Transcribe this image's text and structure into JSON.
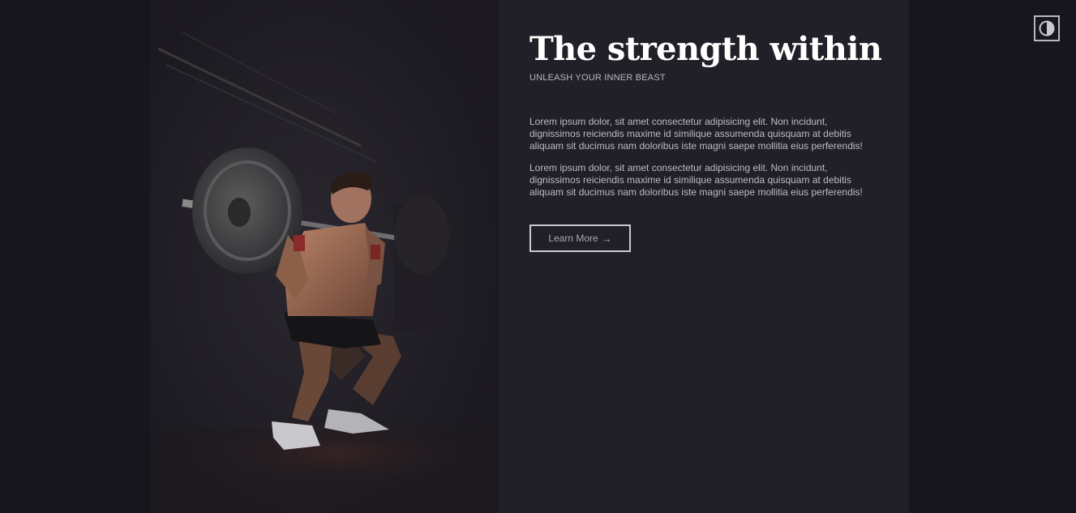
{
  "hero": {
    "title": "The strength within",
    "subtitle": "UNLEASH YOUR INNER BEAST",
    "paragraphs": [
      "Lorem ipsum dolor, sit amet consectetur adipisicing elit. Non incidunt, dignissimos reiciendis maxime id similique assumenda quisquam at debitis aliquam sit ducimus nam doloribus iste magni saepe mollitia eius perferendis!",
      "Lorem ipsum dolor, sit amet consectetur adipisicing elit. Non incidunt, dignissimos reiciendis maxime id similique assumenda quisquam at debitis aliquam sit ducimus nam doloribus iste magni saepe mollitia eius perferendis!"
    ],
    "cta_label": "Learn More",
    "cta_arrow": "→",
    "image_icon": "weightlifter-squat-photo"
  },
  "theme_toggle": {
    "icon": "contrast-icon"
  },
  "colors": {
    "page_background": "#17151d",
    "card_background": "#211f28",
    "title": "#ffffff",
    "body_text": "#bdbbc4",
    "button_border": "#c9c7cf"
  }
}
